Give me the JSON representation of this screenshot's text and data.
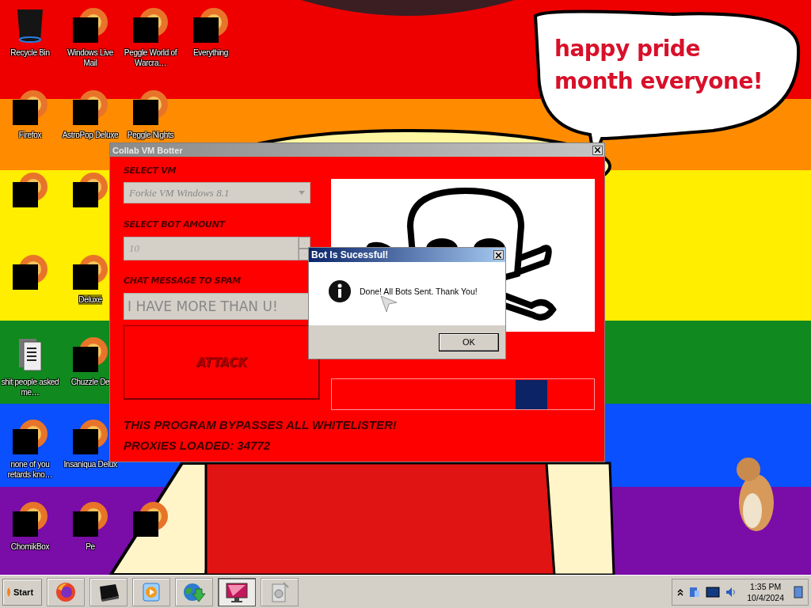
{
  "wallpaper": {
    "kind": "picture",
    "caption": "happy pride month everyone!"
  },
  "desktop_icons": [
    [
      {
        "kind": "bin",
        "label": "Recycle Bin"
      },
      {
        "kind": "censored",
        "label": "Windows Live Mail"
      },
      {
        "kind": "censored",
        "label": "Peggle World of Warcra…"
      },
      {
        "kind": "censored",
        "label": "Everything"
      }
    ],
    [
      {
        "kind": "censored",
        "label": "Firefox"
      },
      {
        "kind": "censored",
        "label": "AstroPop Deluxe"
      },
      {
        "kind": "censored",
        "label": "Peggle Nights"
      }
    ],
    [
      {
        "kind": "censored"
      },
      {
        "kind": "censored"
      }
    ],
    [
      {
        "kind": "censored"
      },
      {
        "kind": "censored",
        "label": "Deluxe"
      }
    ],
    [
      {
        "kind": "folder",
        "label": "shit people asked me…"
      },
      {
        "kind": "censored",
        "label": "Chuzzle De"
      }
    ],
    [
      {
        "kind": "censored",
        "label": "none of you retards kno…"
      },
      {
        "kind": "censored",
        "label": "Insaniqua Delux"
      }
    ],
    [
      {
        "kind": "censored",
        "label": "ChomikBox"
      },
      {
        "kind": "censored",
        "label": "Pe"
      },
      {
        "kind": "censored"
      }
    ]
  ],
  "botter_window": {
    "title": "Collab VM Botter",
    "vm_label": "SELECT VM",
    "vm_value": "Forkie VM Windows 8.1",
    "amount_label": "SELECT BOT AMOUNT",
    "amount_value": "10",
    "message_label": "CHAT MESSAGE TO SPAM",
    "message_value": "I HAVE MORE THAN U!",
    "attack_button": "ATTACK",
    "notice": "THIS PROGRAM BYPASSES ALL WHITELISTER!",
    "proxies": "PROXIES LOADED: 34772"
  },
  "dialog": {
    "title": "Bot Is Sucessful!",
    "message": "Done! All Bots Sent. Thank You!",
    "button": "OK"
  },
  "taskbar": {
    "start": "Start",
    "buttons": [
      {
        "kind": "firefox",
        "selected": false
      },
      {
        "kind": "terminal",
        "selected": false
      },
      {
        "kind": "media",
        "selected": false
      },
      {
        "kind": "globe",
        "selected": false
      },
      {
        "kind": "monitor",
        "selected": true
      },
      {
        "kind": "disk",
        "selected": false
      }
    ],
    "time": "1:35 PM",
    "date": "10/4/2024"
  }
}
